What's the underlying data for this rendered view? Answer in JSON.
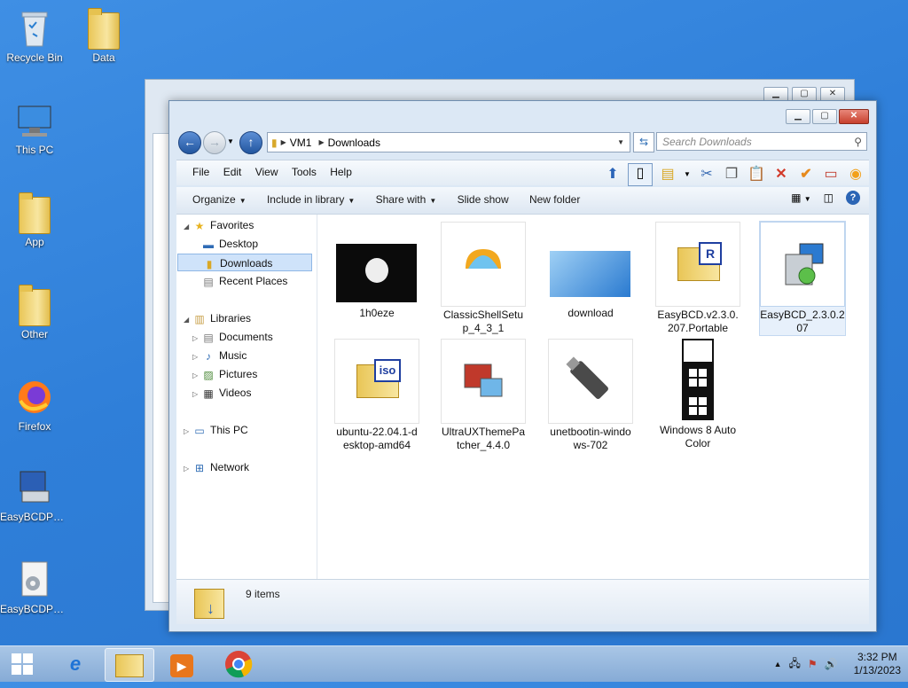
{
  "desktop": {
    "icons": [
      {
        "label": "Recycle Bin"
      },
      {
        "label": "Data"
      },
      {
        "label": "This PC"
      },
      {
        "label": "App"
      },
      {
        "label": "Other"
      },
      {
        "label": "Firefox"
      },
      {
        "label": "EasyBCDPor..."
      },
      {
        "label": "EasyBCDPor..."
      }
    ]
  },
  "explorer": {
    "address": {
      "seg1": "VM1",
      "seg2": "Downloads"
    },
    "search_placeholder": "Search Downloads",
    "menu": [
      "File",
      "Edit",
      "View",
      "Tools",
      "Help"
    ],
    "commands": {
      "organize": "Organize",
      "include": "Include in library",
      "share": "Share with",
      "slideshow": "Slide show",
      "newfolder": "New folder"
    },
    "nav": {
      "favorites": "Favorites",
      "desktop": "Desktop",
      "downloads": "Downloads",
      "recent": "Recent Places",
      "libraries": "Libraries",
      "documents": "Documents",
      "music": "Music",
      "pictures": "Pictures",
      "videos": "Videos",
      "thispc": "This PC",
      "network": "Network"
    },
    "files": [
      {
        "name": "1h0eze"
      },
      {
        "name": "ClassicShellSetup_4_3_1"
      },
      {
        "name": "download"
      },
      {
        "name": "EasyBCD.v2.3.0.207.Portable"
      },
      {
        "name": "EasyBCD_2.3.0.207"
      },
      {
        "name": "ubuntu-22.04.1-desktop-amd64"
      },
      {
        "name": "UltraUXThemePatcher_4.4.0"
      },
      {
        "name": "unetbootin-windows-702"
      },
      {
        "name": "Windows 8 Auto Color"
      }
    ],
    "status": "9 items",
    "iso_label": "iso",
    "r_label": "R"
  },
  "taskbar": {
    "time": "3:32 PM",
    "date": "1/13/2023"
  }
}
